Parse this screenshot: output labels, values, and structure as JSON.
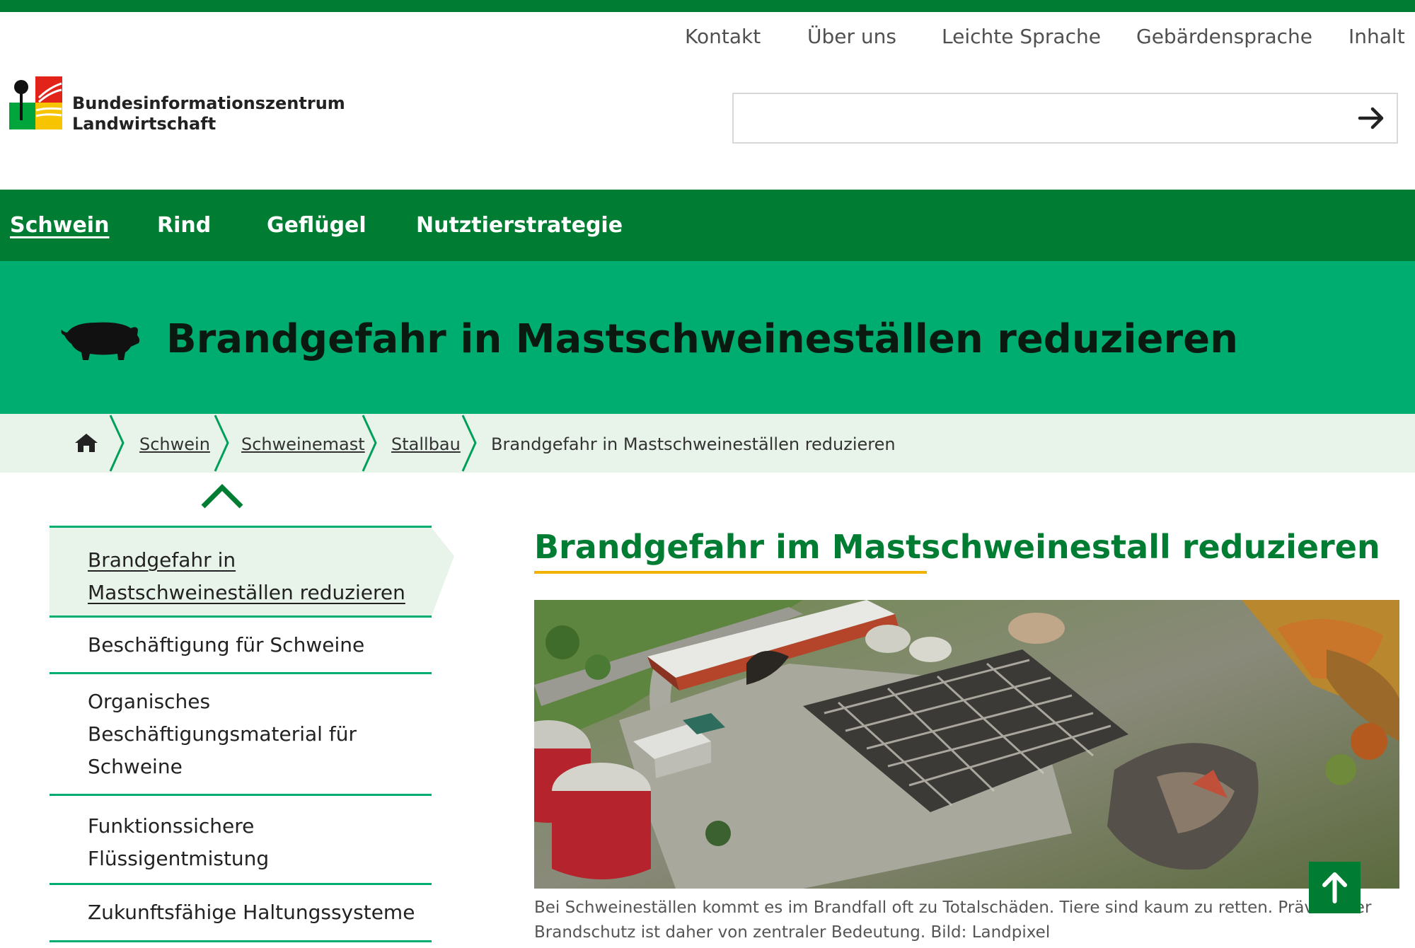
{
  "service_nav": {
    "items": [
      {
        "label": "Kontakt"
      },
      {
        "label": "Über uns"
      },
      {
        "label": "Leichte Sprache"
      },
      {
        "label": "Gebärdensprache"
      },
      {
        "label": "Inhalt"
      }
    ]
  },
  "logo": {
    "line1": "Bundesinformationszentrum",
    "line2": "Landwirtschaft"
  },
  "search": {
    "value": "",
    "placeholder": "",
    "button_icon": "arrow-right-icon"
  },
  "main_nav": {
    "items": [
      {
        "label": "Schwein",
        "active": true
      },
      {
        "label": "Rind"
      },
      {
        "label": "Geflügel"
      },
      {
        "label": "Nutztierstrategie"
      }
    ]
  },
  "hero": {
    "icon": "pig-icon",
    "title": "Brandgefahr in Mastschweineställen reduzieren"
  },
  "breadcrumb": {
    "home_icon": "home-icon",
    "items": [
      {
        "label": "Schwein"
      },
      {
        "label": "Schweinemast"
      },
      {
        "label": "Stallbau"
      }
    ],
    "current": "Brandgefahr in Mastschweineställen reduzieren"
  },
  "sidebar": {
    "collapse_icon": "chevron-up-icon",
    "items": [
      {
        "lines": [
          "Brandgefahr in",
          "Mastschweineställen reduzieren"
        ],
        "active": true
      },
      {
        "lines": [
          "Beschäftigung für Schweine"
        ]
      },
      {
        "lines": [
          "Organisches",
          "Beschäftigungsmaterial für",
          "Schweine"
        ]
      },
      {
        "lines": [
          "Funktionssichere",
          "Flüssigentmistung"
        ]
      },
      {
        "lines": [
          "Zukunftsfähige Haltungssysteme"
        ]
      }
    ]
  },
  "article": {
    "title": "Brandgefahr im Mastschweinestall reduzieren",
    "caption_line1": "Bei Schweineställen kommt es im Brandfall oft zu Totalschäden. Tiere sind kaum zu retten. Präventiver",
    "caption_line2": "Brandschutz ist daher von zentraler Bedeutung. Bild: Landpixel"
  },
  "colors": {
    "brand_green": "#007d32",
    "hero_green": "#00ad71",
    "breadcrumb_bg": "#e8f3ea",
    "accent_yellow": "#f0b400"
  },
  "back_to_top_icon": "arrow-up-icon"
}
